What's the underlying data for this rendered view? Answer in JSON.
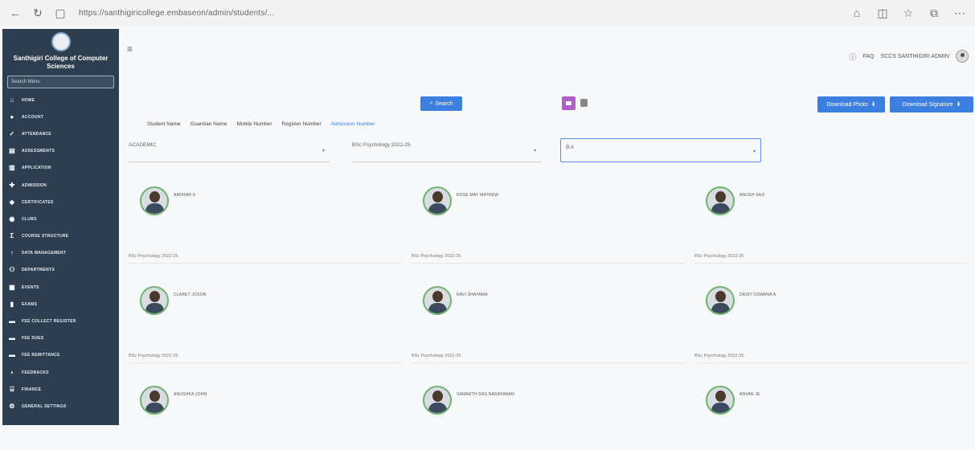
{
  "browser": {
    "url": "https://santhigiricollege.embaseon/admin/students/..."
  },
  "sidebar": {
    "college_name": "Santhigiri College of Computer Sciences",
    "search_placeholder": "Search Menu",
    "items": [
      {
        "label": "HOME",
        "icon": "home-icon"
      },
      {
        "label": "ACCOUNT",
        "icon": "person-icon"
      },
      {
        "label": "ATTENDANCE",
        "icon": "check-icon"
      },
      {
        "label": "ASSESSMENTS",
        "icon": "clipboard-icon"
      },
      {
        "label": "APPLICATION",
        "icon": "document-icon"
      },
      {
        "label": "ADMISSION",
        "icon": "user-plus-icon"
      },
      {
        "label": "CERTIFICATES",
        "icon": "ribbon-icon"
      },
      {
        "label": "CLUBS",
        "icon": "group-icon"
      },
      {
        "label": "COURSE STRUCTURE",
        "icon": "sum-icon"
      },
      {
        "label": "DATA MANAGEMENT",
        "icon": "arrow-icon"
      },
      {
        "label": "DEPARTMENTS",
        "icon": "people-icon"
      },
      {
        "label": "EVENTS",
        "icon": "calendar-icon"
      },
      {
        "label": "EXAMS",
        "icon": "exam-icon"
      },
      {
        "label": "FEE COLLECT REGISTER",
        "icon": "register-icon"
      },
      {
        "label": "FEE DUES",
        "icon": "dues-icon"
      },
      {
        "label": "FEE REMITTANCE",
        "icon": "remit-icon"
      },
      {
        "label": "FEEDBACKS",
        "icon": "feedback-icon"
      },
      {
        "label": "FINANCE",
        "icon": "bank-icon"
      },
      {
        "label": "GENERAL SETTINGS",
        "icon": "settings-icon"
      }
    ]
  },
  "header": {
    "faq": "FAQ",
    "user_label": "SCCS SANTHIGIRI ADMIN"
  },
  "toolbar": {
    "search_label": "Search",
    "download_photo_label": "Download Photo",
    "download_signature_label": "Download Signature"
  },
  "tabs": [
    "Student Name",
    "Guardian Name",
    "Mobile Number",
    "Register Number",
    "Admission Number"
  ],
  "filters": {
    "first_value": "ACADEMIC",
    "second_value": "BSc Psychology 2022-25",
    "third_value": "B A"
  },
  "students": [
    {
      "name": "AADHAR S"
    },
    {
      "name": "ROSE MAY MATHEW"
    },
    {
      "name": "ANUSH SAJI"
    },
    {
      "name": "CLARET JOSON"
    },
    {
      "name": "RAVI SHAYAMA"
    },
    {
      "name": "DAISY OSWANA A"
    },
    {
      "name": "ANUSHKA JOHN"
    },
    {
      "name": "SAMARTH DAS NARAYANAN"
    },
    {
      "name": "ANVAN JE"
    }
  ],
  "card_detail": {
    "col_text": "BSc Psychology 2022-25"
  },
  "colors": {
    "sidebar_bg": "#2d3e50",
    "accent": "#3d7fe0",
    "purple": "#b15fc7"
  }
}
